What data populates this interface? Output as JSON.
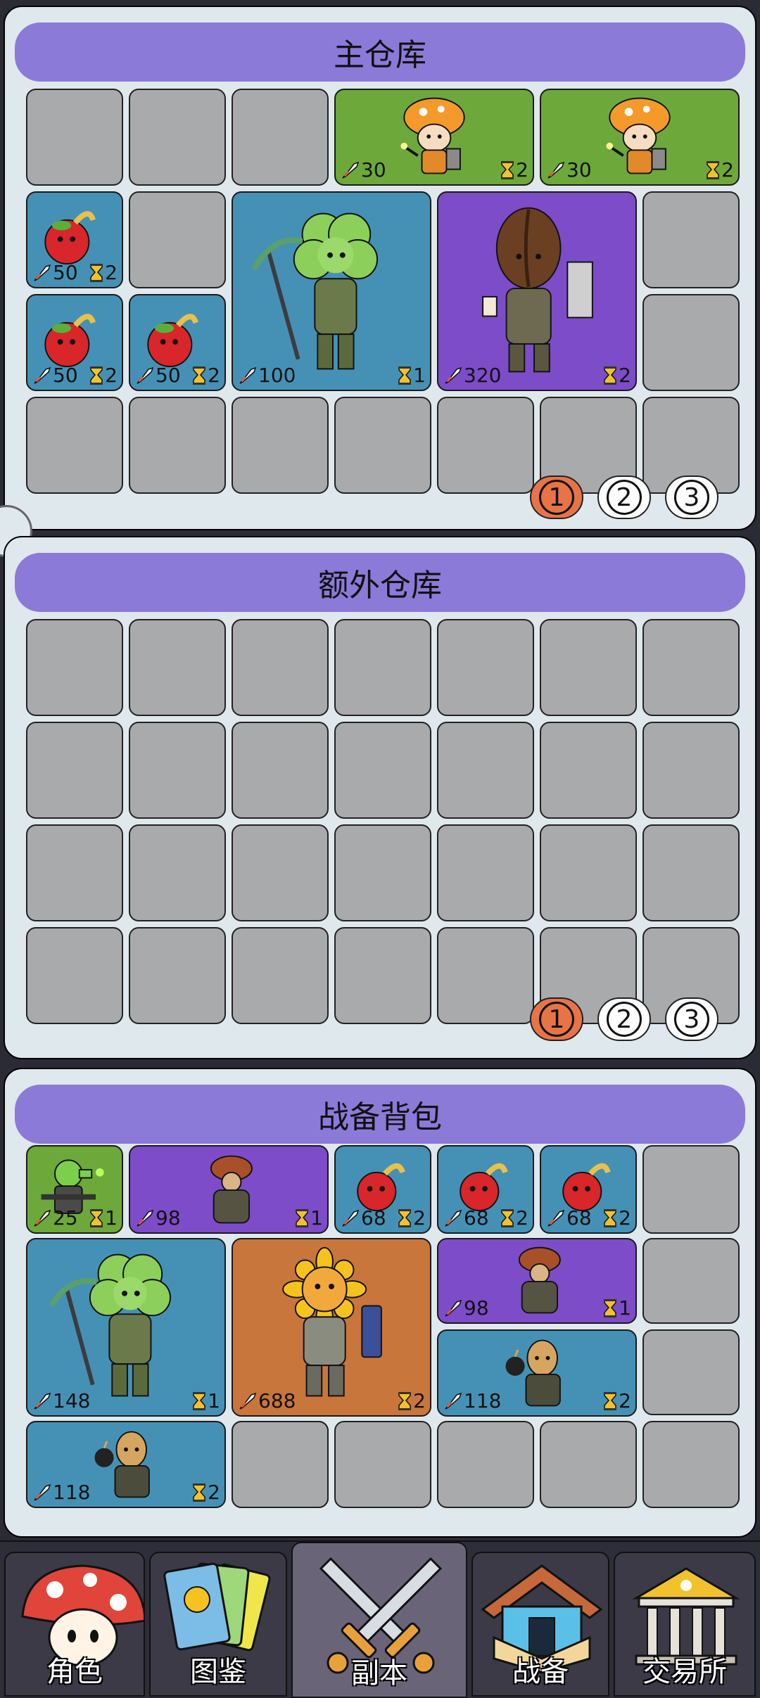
{
  "main_storage": {
    "title": "主仓库",
    "items": [
      {
        "kind": "mushroom-scout",
        "bg": "green",
        "attack": "30",
        "time": "2"
      },
      {
        "kind": "mushroom-scout",
        "bg": "green",
        "attack": "30",
        "time": "2"
      },
      {
        "kind": "cherry-bomb",
        "bg": "blue",
        "attack": "50",
        "time": "2"
      },
      {
        "kind": "cherry-bomb",
        "bg": "blue",
        "attack": "50",
        "time": "2"
      },
      {
        "kind": "cherry-bomb",
        "bg": "blue",
        "attack": "50",
        "time": "2"
      },
      {
        "kind": "clover-soldier",
        "bg": "blue",
        "attack": "100",
        "time": "1"
      },
      {
        "kind": "coffee-bean-soldier",
        "bg": "purple",
        "attack": "320",
        "time": "2"
      }
    ],
    "pages": [
      "1",
      "2",
      "3"
    ],
    "active_page": "1"
  },
  "extra_storage": {
    "title": "额外仓库",
    "pages": [
      "1",
      "2",
      "3"
    ],
    "active_page": "1"
  },
  "combat_bag": {
    "title": "战备背包",
    "items": [
      {
        "kind": "peashooter-gunner",
        "bg": "green",
        "attack": "25",
        "time": "1"
      },
      {
        "kind": "mushroom-heavy",
        "bg": "purple",
        "attack": "98",
        "time": "1"
      },
      {
        "kind": "cherry-bomb",
        "bg": "blue",
        "attack": "68",
        "time": "2"
      },
      {
        "kind": "cherry-bomb",
        "bg": "blue",
        "attack": "68",
        "time": "2"
      },
      {
        "kind": "cherry-bomb",
        "bg": "blue",
        "attack": "68",
        "time": "2"
      },
      {
        "kind": "clover-soldier",
        "bg": "blue",
        "attack": "148",
        "time": "1"
      },
      {
        "kind": "sunflower-soldier",
        "bg": "orange",
        "attack": "688",
        "time": "2"
      },
      {
        "kind": "mushroom-heavy",
        "bg": "purple",
        "attack": "98",
        "time": "1"
      },
      {
        "kind": "potato-bomber",
        "bg": "blue",
        "attack": "118",
        "time": "2"
      },
      {
        "kind": "potato-bomber",
        "bg": "blue",
        "attack": "118",
        "time": "2"
      }
    ]
  },
  "nav": {
    "tabs": [
      {
        "label": "角色",
        "icon": "mushroom-icon"
      },
      {
        "label": "图鉴",
        "icon": "cards-icon"
      },
      {
        "label": "副本",
        "icon": "crossed-swords-icon"
      },
      {
        "label": "战备",
        "icon": "house-icon"
      },
      {
        "label": "交易所",
        "icon": "bank-icon"
      }
    ],
    "active": "副本"
  },
  "colors": {
    "title_bar": "#8b7ad8",
    "empty_slot": "#a9aaac",
    "green": "#6da83b",
    "blue": "#4591b5",
    "purple": "#7d4cc8",
    "orange": "#c8763b",
    "active_page": "#e87446"
  }
}
